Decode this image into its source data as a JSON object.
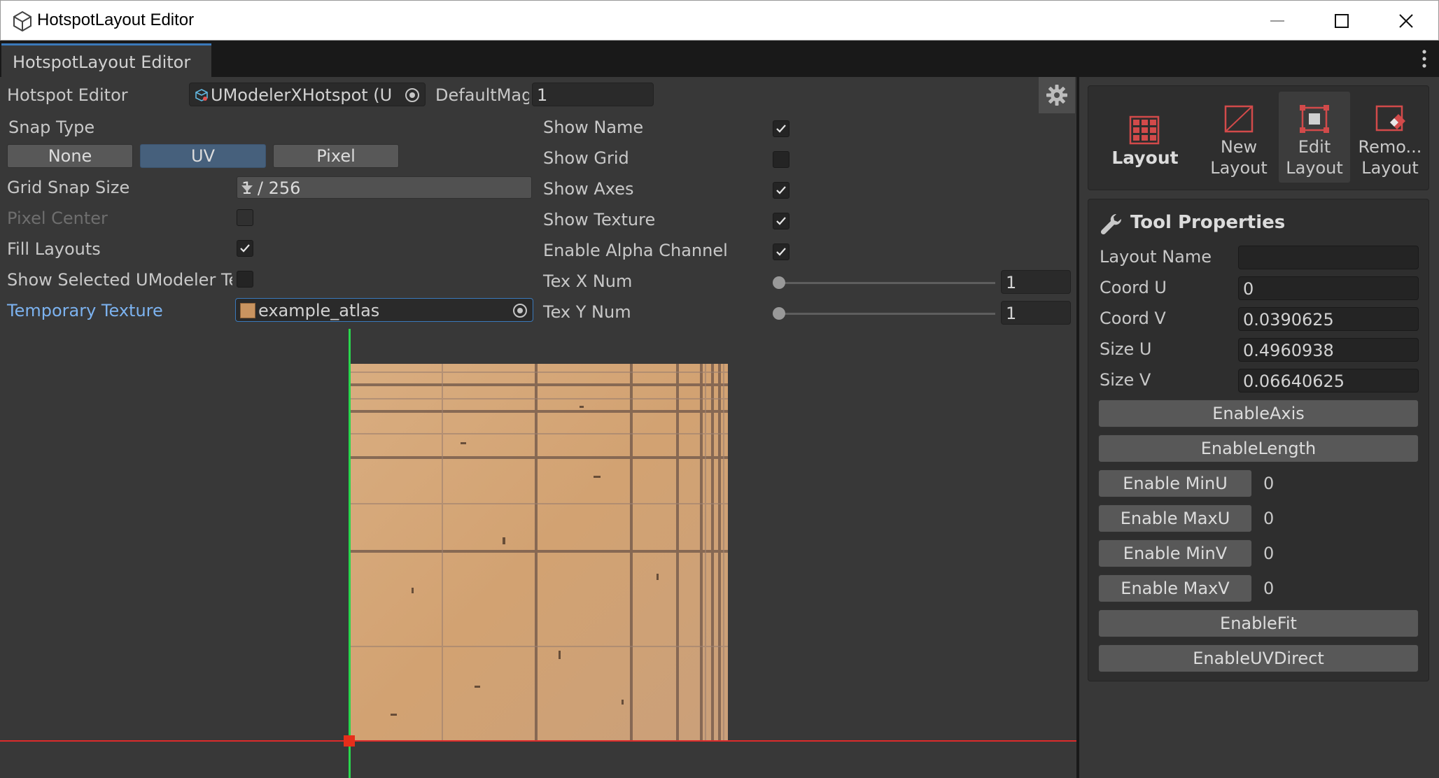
{
  "window": {
    "title": "HotspotLayout Editor"
  },
  "tab": {
    "label": "HotspotLayout Editor"
  },
  "header": {
    "hotspot_editor_label": "Hotspot Editor",
    "hotspot_object": "UModelerXHotspot (U M",
    "default_mag_label": "DefaultMag",
    "default_mag_value": "1"
  },
  "settings": {
    "snap_type_label": "Snap Type",
    "snap_options": [
      "None",
      "UV",
      "Pixel"
    ],
    "snap_selected": "UV",
    "grid_snap_label": "Grid Snap Size",
    "grid_snap_value": "1 / 256",
    "pixel_center_label": "Pixel Center",
    "pixel_center_checked": false,
    "fill_layouts_label": "Fill Layouts",
    "fill_layouts_checked": true,
    "show_selected_label": "Show Selected UModeler Te",
    "show_selected_checked": false,
    "temp_texture_label": "Temporary Texture",
    "temp_texture_value": "example_atlas"
  },
  "display": {
    "show_name_label": "Show Name",
    "show_name_checked": true,
    "show_grid_label": "Show Grid",
    "show_grid_checked": false,
    "show_axes_label": "Show Axes",
    "show_axes_checked": true,
    "show_texture_label": "Show Texture",
    "show_texture_checked": true,
    "alpha_label": "Enable Alpha Channel",
    "alpha_checked": true,
    "tex_x_label": "Tex X Num",
    "tex_x_value": "1",
    "tex_y_label": "Tex Y Num",
    "tex_y_value": "1"
  },
  "tools": {
    "layout": "Layout",
    "new_layout_1": "New",
    "new_layout_2": "Layout",
    "edit_layout_1": "Edit",
    "edit_layout_2": "Layout",
    "remove_layout_1": "Remo...",
    "remove_layout_2": "Layout"
  },
  "tool_properties": {
    "title": "Tool Properties",
    "layout_name_label": "Layout Name",
    "layout_name_value": "",
    "coord_u_label": "Coord U",
    "coord_u_value": "0",
    "coord_v_label": "Coord V",
    "coord_v_value": "0.0390625",
    "size_u_label": "Size U",
    "size_u_value": "0.4960938",
    "size_v_label": "Size V",
    "size_v_value": "0.06640625",
    "enable_axis": "EnableAxis",
    "enable_length": "EnableLength",
    "enable_minu": "Enable MinU",
    "minu_value": "0",
    "enable_maxu": "Enable MaxU",
    "maxu_value": "0",
    "enable_minv": "Enable MinV",
    "minv_value": "0",
    "enable_maxv": "Enable MaxV",
    "maxv_value": "0",
    "enable_fit": "EnableFit",
    "enable_uvdirect": "EnableUVDirect"
  },
  "colors": {
    "accent": "#3a79bb",
    "axis_x": "#dc2b2b",
    "axis_y": "#29d64d",
    "link": "#7cb2ef"
  }
}
